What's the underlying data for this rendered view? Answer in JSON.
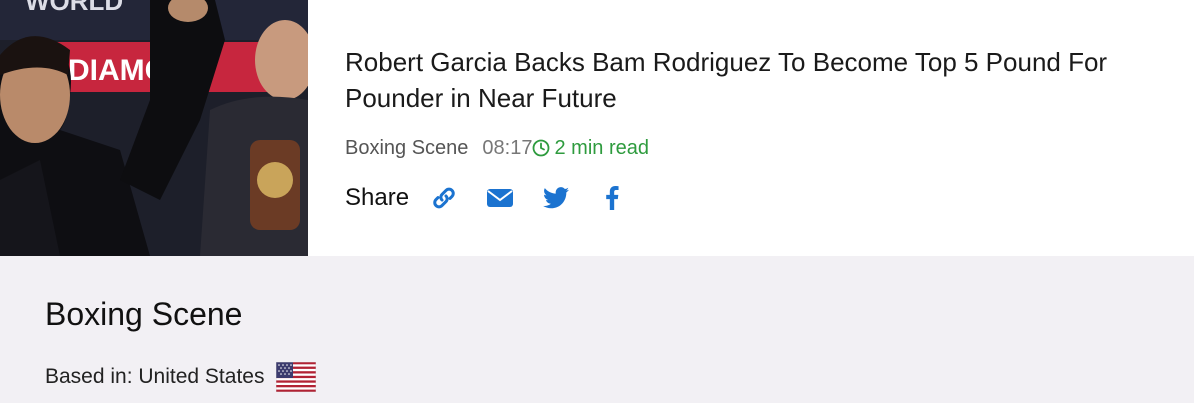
{
  "article": {
    "title": "Robert Garcia Backs Bam Rodriguez To Become Top 5 Pound For Pounder in Near Future",
    "source": "Boxing Scene",
    "time": "08:17",
    "read_time": "2 min read",
    "thumbnail_text": [
      "WORLD",
      "DIAMO"
    ]
  },
  "share": {
    "label": "Share",
    "icons": [
      "link-icon",
      "email-icon",
      "twitter-icon",
      "facebook-icon"
    ],
    "icon_color": "#1b73d0"
  },
  "source_panel": {
    "name": "Boxing Scene",
    "based_in": "Based in: United States",
    "flag": "us-flag"
  },
  "colors": {
    "read_time": "#2e9b3e",
    "panel_bg": "#f2f0f4"
  }
}
